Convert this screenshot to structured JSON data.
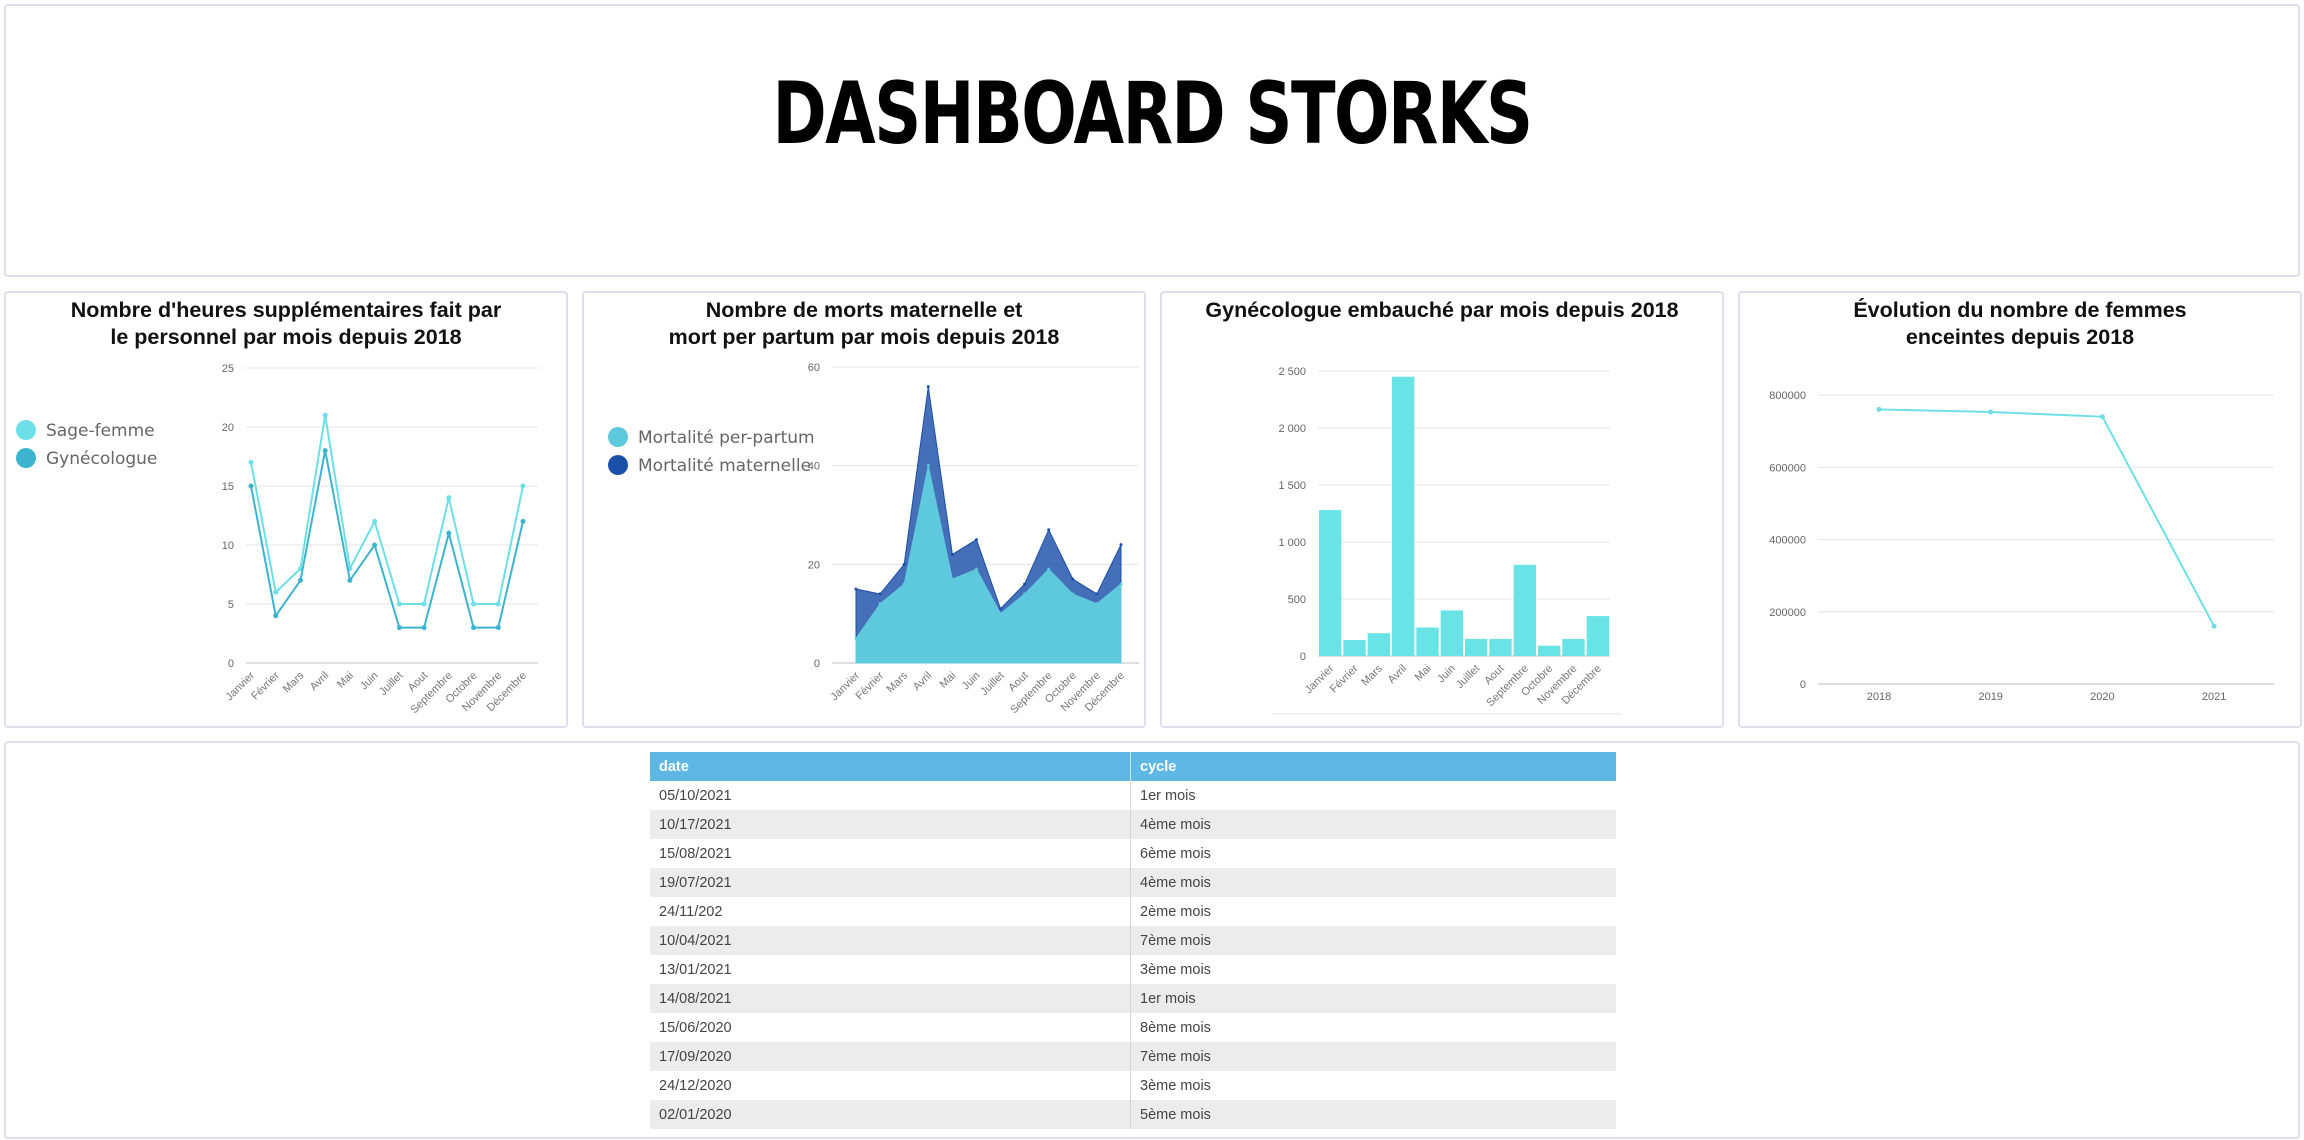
{
  "header": {
    "title": "DASHBOARD STORKS"
  },
  "charts": [
    {
      "title": "Nombre d'heures supplémentaires fait par\nle personnel par mois depuis 2018"
    },
    {
      "title": "Nombre de morts maternelle et\nmort per partum par mois depuis 2018"
    },
    {
      "title": "Gynécologue embauché par mois depuis 2018"
    },
    {
      "title": "Évolution du nombre de femmes\nenceintes depuis 2018"
    }
  ],
  "chart_data": [
    {
      "type": "line",
      "categories": [
        "Janvier",
        "Février",
        "Mars",
        "Avril",
        "Mai",
        "Juin",
        "Juillet",
        "Aout",
        "Septembre",
        "Octobre",
        "Novembre",
        "Décembre"
      ],
      "series": [
        {
          "name": "Sage-femme",
          "color": "#6ddfe6",
          "values": [
            17,
            6,
            8,
            21,
            8,
            12,
            5,
            5,
            14,
            5,
            5,
            15
          ]
        },
        {
          "name": "Gynécologue",
          "color": "#3cb4cf",
          "values": [
            15,
            4,
            7,
            18,
            7,
            10,
            3,
            3,
            11,
            3,
            3,
            12
          ]
        }
      ],
      "ylim": [
        0,
        25
      ],
      "yticks": [
        "0",
        "5",
        "10",
        "15",
        "20",
        "25"
      ],
      "legend": "left",
      "grid": true
    },
    {
      "type": "area",
      "categories": [
        "Janvier",
        "Février",
        "Mars",
        "Avril",
        "Mai",
        "Juin",
        "Juillet",
        "Aout",
        "Septembre",
        "Octobre",
        "Novembre",
        "Décembre"
      ],
      "series": [
        {
          "name": "Mortalité per-partum",
          "color": "#5ec8dc",
          "values": [
            5,
            12,
            16,
            40,
            17,
            19,
            10,
            14,
            19,
            14,
            12,
            16
          ]
        },
        {
          "name": "Mortalité maternelle",
          "color": "#1c4fa8",
          "values": [
            15,
            14,
            20,
            56,
            22,
            25,
            11,
            16,
            27,
            17,
            14,
            24
          ]
        }
      ],
      "ylim": [
        0,
        60
      ],
      "yticks": [
        "0",
        "20",
        "40",
        "60"
      ],
      "legend": "left",
      "grid": true
    },
    {
      "type": "bar",
      "categories": [
        "Janvier",
        "Février",
        "Mars",
        "Avril",
        "Mai",
        "Juin",
        "Juillet",
        "Aout",
        "Septembre",
        "Octobre",
        "Novembre",
        "Décembre"
      ],
      "series": [
        {
          "name": "",
          "color": "#6ae3e6",
          "values": [
            1280,
            140,
            200,
            2450,
            250,
            400,
            150,
            150,
            800,
            90,
            150,
            350
          ]
        }
      ],
      "ylim": [
        0,
        2500
      ],
      "yticks": [
        "0",
        "500",
        "1 000",
        "1 500",
        "2 000",
        "2 500"
      ],
      "grid": true
    },
    {
      "type": "line",
      "categories": [
        "2018",
        "2019",
        "2020",
        "2021"
      ],
      "series": [
        {
          "name": "",
          "color": "#6ddfe6",
          "values": [
            760000,
            753000,
            740000,
            160000
          ]
        }
      ],
      "ylim": [
        0,
        800000
      ],
      "yticks": [
        "0",
        "200000",
        "400000",
        "600000",
        "800000"
      ],
      "grid": true
    }
  ],
  "table": {
    "headers": [
      "date",
      "cycle"
    ],
    "rows": [
      [
        "05/10/2021",
        "1er mois"
      ],
      [
        "10/17/2021",
        "4ème mois"
      ],
      [
        "15/08/2021",
        "6ème mois"
      ],
      [
        "19/07/2021",
        "4ème mois"
      ],
      [
        "24/11/202",
        "2ème mois"
      ],
      [
        "10/04/2021",
        "7ème mois"
      ],
      [
        "13/01/2021",
        "3ème mois"
      ],
      [
        "14/08/2021",
        "1er mois"
      ],
      [
        "15/06/2020",
        "8ème mois"
      ],
      [
        "17/09/2020",
        "7ème mois"
      ],
      [
        "24/12/2020",
        "3ème mois"
      ],
      [
        "02/01/2020",
        "5ème mois"
      ]
    ]
  }
}
